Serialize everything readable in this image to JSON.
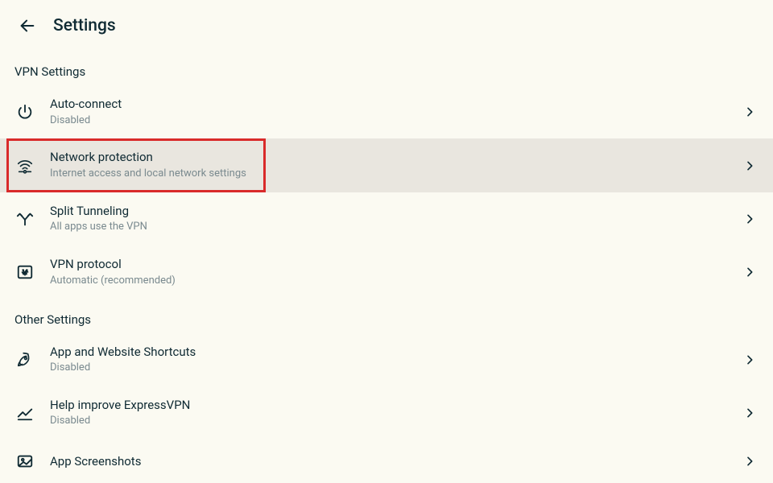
{
  "header": {
    "title": "Settings"
  },
  "sections": {
    "vpn": {
      "header": "VPN Settings",
      "auto_connect": {
        "title": "Auto-connect",
        "sub": "Disabled"
      },
      "network_protection": {
        "title": "Network protection",
        "sub": "Internet access and local network settings"
      },
      "split_tunneling": {
        "title": "Split Tunneling",
        "sub": "All apps use the VPN"
      },
      "vpn_protocol": {
        "title": "VPN protocol",
        "sub": "Automatic (recommended)"
      }
    },
    "other": {
      "header": "Other Settings",
      "shortcuts": {
        "title": "App and Website Shortcuts",
        "sub": "Disabled"
      },
      "help_improve": {
        "title": "Help improve ExpressVPN",
        "sub": "Disabled"
      },
      "app_screenshots": {
        "title": "App Screenshots"
      }
    }
  },
  "highlight_color": "#d92a2a"
}
